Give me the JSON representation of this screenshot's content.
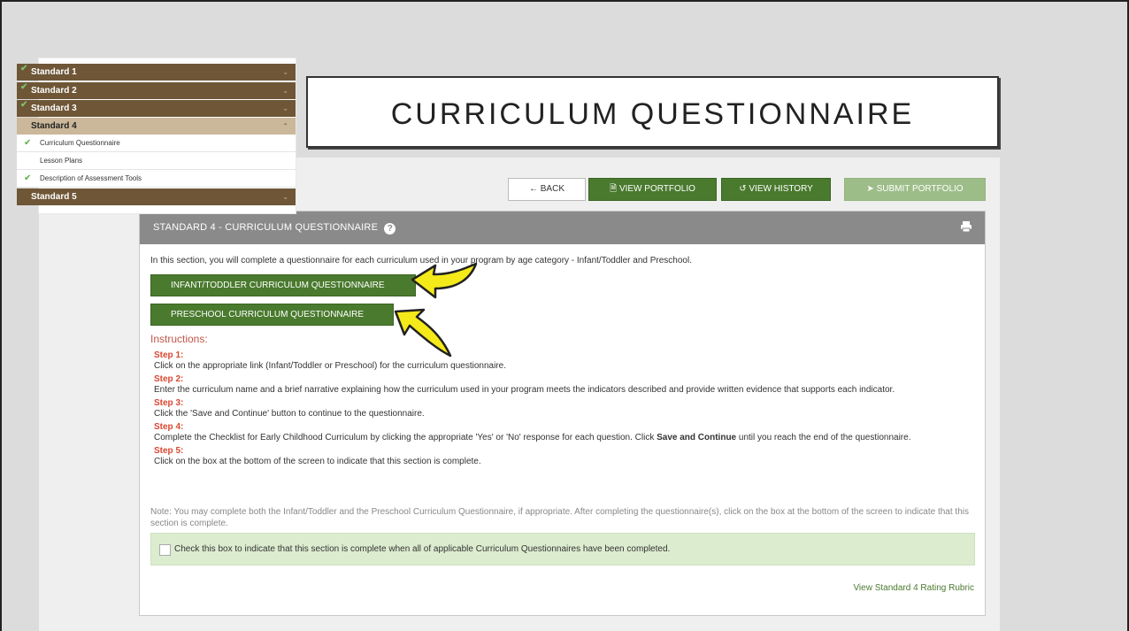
{
  "slide_title": "CURRICULUM QUESTIONNAIRE",
  "sidebar": {
    "items": [
      {
        "label": "Standard 1",
        "checked": true
      },
      {
        "label": "Standard 2",
        "checked": true
      },
      {
        "label": "Standard 3",
        "checked": true
      },
      {
        "label": "Standard 4",
        "checked": false,
        "expanded": true
      },
      {
        "label": "Standard 5",
        "checked": false
      }
    ],
    "sub_items": [
      {
        "label": "Curriculum Questionnaire",
        "checked": true
      },
      {
        "label": "Lesson Plans",
        "checked": false
      },
      {
        "label": "Description of Assessment Tools",
        "checked": true
      }
    ]
  },
  "toolbar": {
    "back": "BACK",
    "view_portfolio": "VIEW PORTFOLIO",
    "view_history": "VIEW HISTORY",
    "submit_portfolio": "SUBMIT PORTFOLIO"
  },
  "panel": {
    "title": "STANDARD 4 - CURRICULUM QUESTIONNAIRE",
    "intro": "In this section, you will complete a questionnaire for each curriculum used in your program by age category - Infant/Toddler and Preschool.",
    "infant_button": "INFANT/TODDLER CURRICULUM QUESTIONNAIRE",
    "preschool_button": "PRESCHOOL CURRICULUM QUESTIONNAIRE",
    "instructions_title": "Instructions:",
    "steps": [
      {
        "label": "Step 1:",
        "text": "Click on the appropriate link (Infant/Toddler or Preschool) for the curriculum questionnaire."
      },
      {
        "label": "Step 2:",
        "text": "Enter the curriculum name and a brief narrative explaining how the curriculum used in your program meets the indicators described and provide written evidence that supports each indicator."
      },
      {
        "label": "Step 3:",
        "text": "Click the 'Save and Continue' button to continue to the questionnaire."
      },
      {
        "label": "Step 4:",
        "text_before": "Complete the Checklist for Early Childhood Curriculum by clicking the appropriate 'Yes' or 'No' response for each question. Click ",
        "text_bold": "Save and Continue",
        "text_after": " until you reach the end of the questionnaire."
      },
      {
        "label": "Step 5:",
        "text": "Click on the box at the bottom of the screen to indicate that this section is complete."
      }
    ],
    "note": "Note: You may complete both the Infant/Toddler and the Preschool Curriculum Questionnaire, if appropriate. After completing the questionnaire(s), click on the box at the bottom of the screen to indicate that this section is complete.",
    "checkbox_label": "Check this box to indicate that this section is complete when all of applicable Curriculum Questionnaires have been completed.",
    "rubric_link": "View Standard 4 Rating Rubric"
  },
  "colors": {
    "green": "#4a7a2e",
    "green_disabled": "#9dbd88",
    "sidebar_dark": "#6e5636",
    "sidebar_active": "#cbb89a",
    "step_red": "#d9472f",
    "arrow_yellow": "#f4ea1a"
  }
}
